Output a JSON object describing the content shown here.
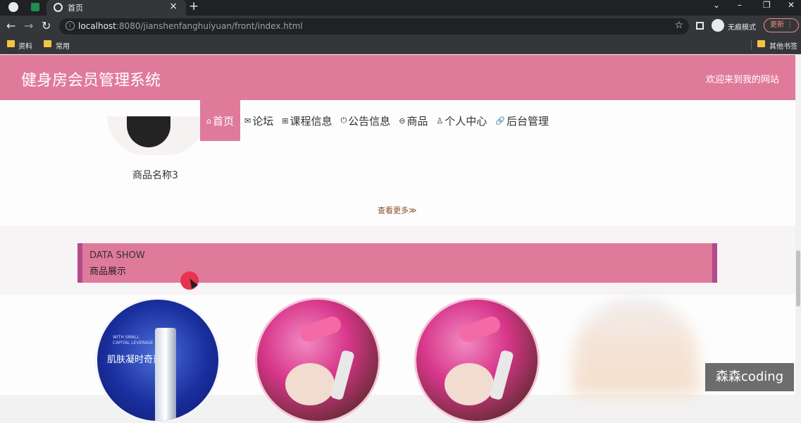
{
  "browser": {
    "tab_title": "首页",
    "url_host": "localhost",
    "url_rest": ":8080/jianshenfanghuiyuan/front/index.html",
    "incognito_label": "无痕模式",
    "update_label": "更新",
    "bookmarks": [
      "资料",
      "常用"
    ],
    "other_bookmarks": "其他书签"
  },
  "site": {
    "title": "健身房会员管理系统",
    "welcome": "欢迎来到我的网站"
  },
  "nav": [
    {
      "label": "首页",
      "icon": "home-icon"
    },
    {
      "label": "论坛",
      "icon": "mail-icon"
    },
    {
      "label": "课程信息",
      "icon": "grid-icon"
    },
    {
      "label": "公告信息",
      "icon": "power-icon"
    },
    {
      "label": "商品",
      "icon": "circle-icon"
    },
    {
      "label": "个人中心",
      "icon": "user-icon"
    },
    {
      "label": "后台管理",
      "icon": "link-icon"
    }
  ],
  "products_top": {
    "item_name": "商品名称3",
    "see_more": "查看更多≫"
  },
  "section": {
    "en": "DATA SHOW",
    "cn": "商品展示"
  },
  "product_image_text": "肌肤凝时奇迹",
  "watermark": "森森coding",
  "colors": {
    "accent": "#e07a9b",
    "accent_dark": "#b24a8c"
  }
}
